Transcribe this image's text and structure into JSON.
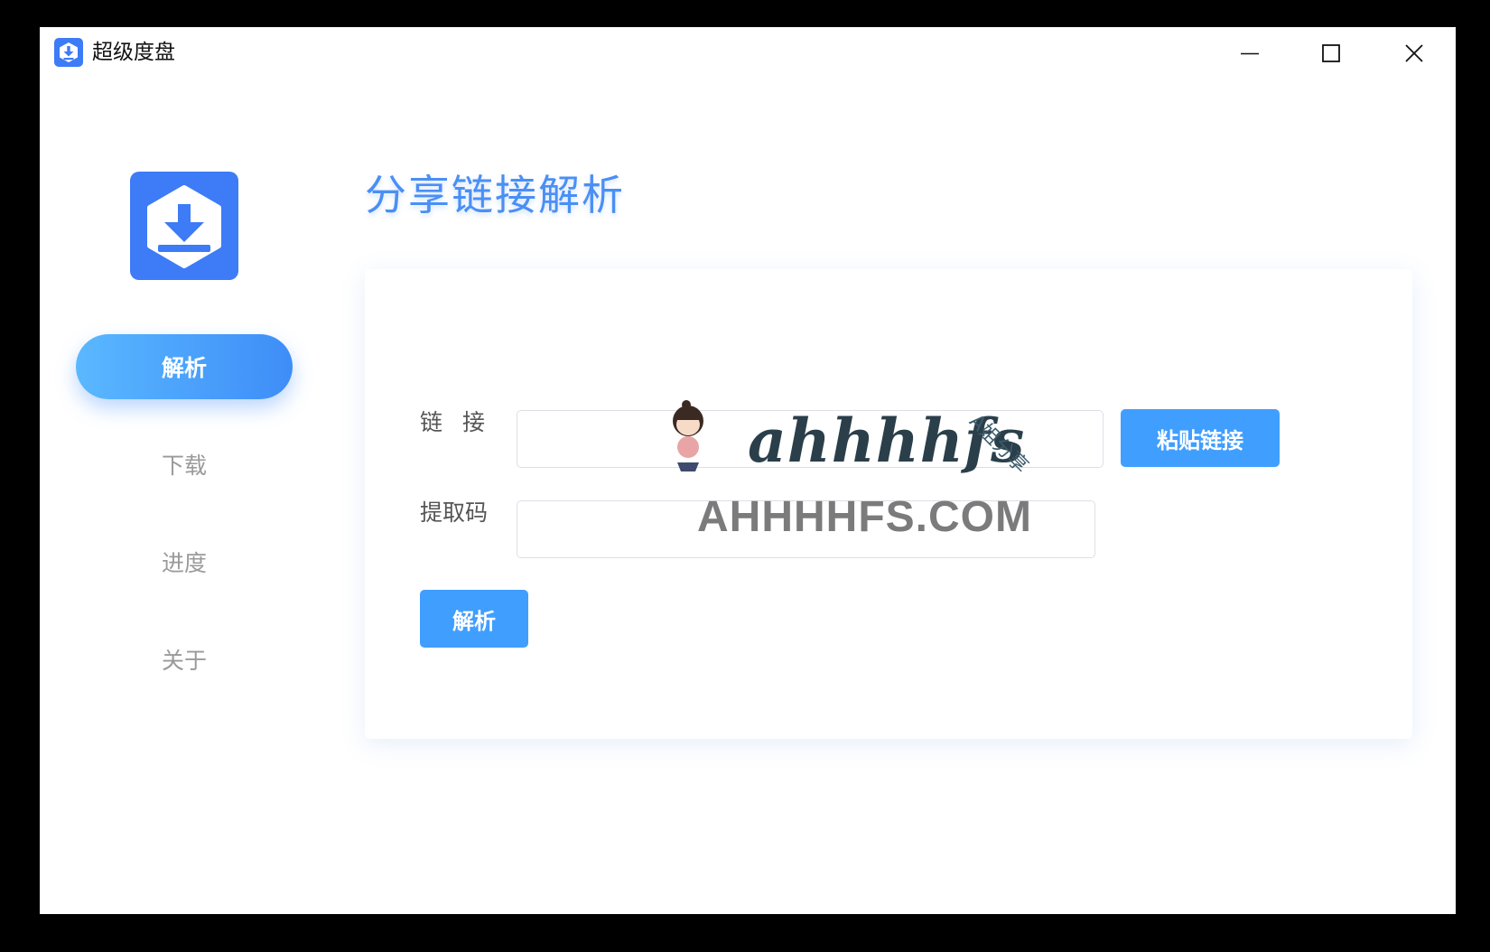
{
  "window": {
    "title": "超级度盘",
    "controls": {
      "minimize": "minimize-icon",
      "maximize": "maximize-icon",
      "close": "close-icon"
    }
  },
  "sidebar": {
    "items": [
      {
        "label": "解析",
        "active": true
      },
      {
        "label": "下载",
        "active": false
      },
      {
        "label": "进度",
        "active": false
      },
      {
        "label": "关于",
        "active": false
      }
    ]
  },
  "main": {
    "title": "分享链接解析",
    "form": {
      "link_label": "链接",
      "link_value": "",
      "paste_button": "粘贴链接",
      "code_label": "提取码",
      "code_value": "",
      "parse_button": "解析"
    }
  },
  "watermark": {
    "script_text": "ahhhhfs",
    "side_text": "A姐分享",
    "big_text": "AHHHHFS.COM"
  },
  "colors": {
    "accent": "#409eff",
    "title_blue": "#4a8ff5",
    "logo_blue": "#3d7bf7",
    "nav_inactive": "#9a9a9a"
  }
}
